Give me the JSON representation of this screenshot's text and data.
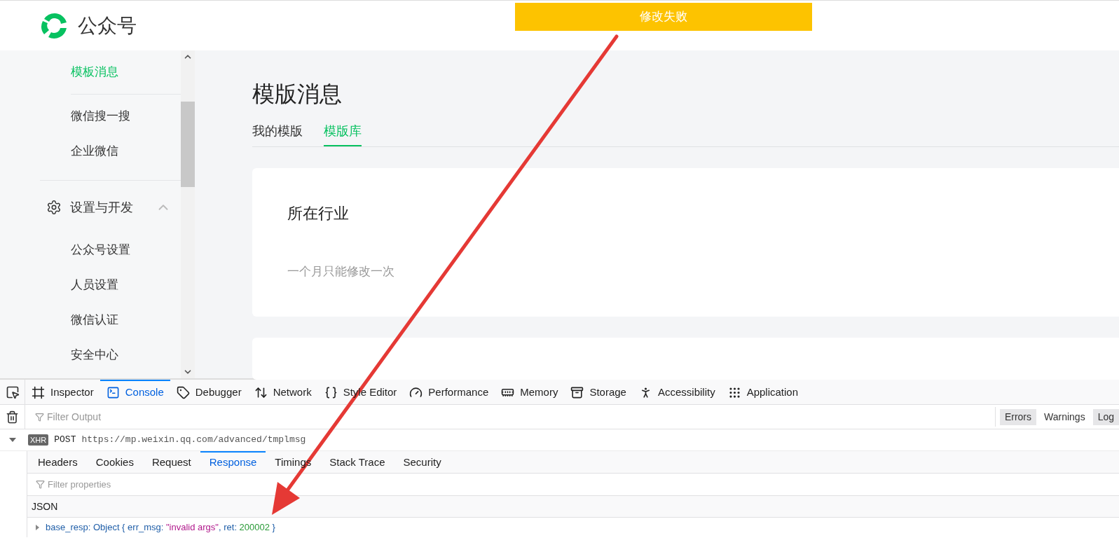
{
  "header": {
    "brand": "公众号"
  },
  "toast": {
    "text": "修改失败"
  },
  "sidebar": {
    "items": [
      {
        "label": "模板消息",
        "selected": true
      },
      {
        "label": "微信搜一搜",
        "selected": false
      },
      {
        "label": "企业微信",
        "selected": false
      }
    ],
    "section": {
      "title": "设置与开发",
      "expanded": true,
      "items": [
        {
          "label": "公众号设置",
          "selected": false
        },
        {
          "label": "人员设置",
          "selected": false
        },
        {
          "label": "微信认证",
          "selected": false
        },
        {
          "label": "安全中心",
          "selected": false
        }
      ]
    }
  },
  "main": {
    "title": "模版消息",
    "tabs": [
      {
        "label": "我的模版",
        "selected": false
      },
      {
        "label": "模版库",
        "selected": true
      }
    ],
    "card": {
      "title": "所在行业",
      "note": "一个月只能修改一次"
    }
  },
  "devtools": {
    "tabs": [
      {
        "label": "Inspector",
        "kind": "inspector",
        "selected": false
      },
      {
        "label": "Console",
        "kind": "console",
        "selected": true
      },
      {
        "label": "Debugger",
        "kind": "debugger",
        "selected": false
      },
      {
        "label": "Network",
        "kind": "network",
        "selected": false
      },
      {
        "label": "Style Editor",
        "kind": "style",
        "selected": false
      },
      {
        "label": "Performance",
        "kind": "performance",
        "selected": false
      },
      {
        "label": "Memory",
        "kind": "memory",
        "selected": false
      },
      {
        "label": "Storage",
        "kind": "storage",
        "selected": false
      },
      {
        "label": "Accessibility",
        "kind": "accessibility",
        "selected": false
      },
      {
        "label": "Application",
        "kind": "application",
        "selected": false
      }
    ],
    "filter": {
      "placeholder": "Filter Output"
    },
    "levels": [
      {
        "label": "Errors",
        "selected": true
      },
      {
        "label": "Warnings",
        "selected": false
      },
      {
        "label": "Log",
        "selected": true
      }
    ],
    "request": {
      "expanded": true,
      "badge": "XHR",
      "method": "POST",
      "url": "https://mp.weixin.qq.com/advanced/tmplmsg"
    },
    "detail_tabs": [
      {
        "label": "Headers",
        "selected": false
      },
      {
        "label": "Cookies",
        "selected": false
      },
      {
        "label": "Request",
        "selected": false
      },
      {
        "label": "Response",
        "selected": true
      },
      {
        "label": "Timings",
        "selected": false
      },
      {
        "label": "Stack Trace",
        "selected": false
      },
      {
        "label": "Security",
        "selected": false
      }
    ],
    "filter_properties": {
      "placeholder": "Filter properties"
    },
    "response": {
      "heading": "JSON",
      "property": {
        "expanded": false,
        "parts": [
          {
            "text": "base_resp: Object { err_msg: ",
            "kind": "key"
          },
          {
            "text": "\"invalid args\"",
            "kind": "string"
          },
          {
            "text": ", ret: ",
            "kind": "key"
          },
          {
            "text": "200002",
            "kind": "number"
          },
          {
            "text": " }",
            "kind": "key"
          }
        ]
      }
    }
  }
}
